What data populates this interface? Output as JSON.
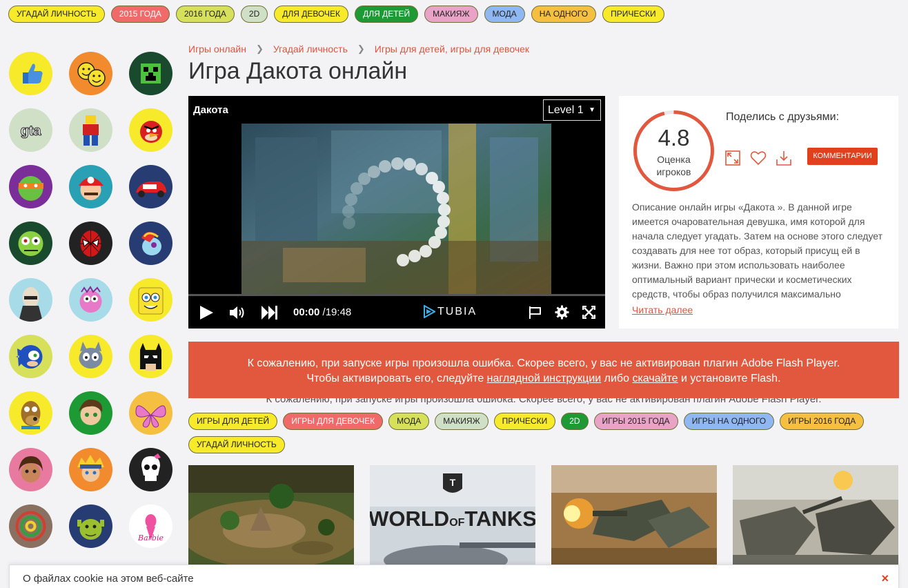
{
  "top_tags": [
    {
      "label": "Угадай личность",
      "color": "#f7ea2a"
    },
    {
      "label": "2015 года",
      "color": "#f06a6a"
    },
    {
      "label": "2016 года",
      "color": "#d7e05a"
    },
    {
      "label": "2D",
      "color": "#cfe0c6"
    },
    {
      "label": "Для девочек",
      "color": "#f7ea2a"
    },
    {
      "label": "Для детей",
      "color": "#1e9a35"
    },
    {
      "label": "Макияж",
      "color": "#e8a3c7"
    },
    {
      "label": "Мода",
      "color": "#8fb8f2"
    },
    {
      "label": "На одного",
      "color": "#f5c042"
    },
    {
      "label": "Прически",
      "color": "#f7ea2a"
    }
  ],
  "sidebar_icons": [
    {
      "name": "like-icon",
      "bg": "#f7ea2a"
    },
    {
      "name": "smiley-icon",
      "bg": "#f28a2e"
    },
    {
      "name": "minecraft-icon",
      "bg": "#1a4a2e"
    },
    {
      "name": "gta-icon",
      "bg": "#cfe0c6"
    },
    {
      "name": "lego-icon",
      "bg": "#cfe0c6"
    },
    {
      "name": "angry-birds-icon",
      "bg": "#f7ea2a"
    },
    {
      "name": "turtle-icon",
      "bg": "#7b2e9a"
    },
    {
      "name": "mario-icon",
      "bg": "#2aa0b4"
    },
    {
      "name": "cars-icon",
      "bg": "#283c74"
    },
    {
      "name": "zombie-icon",
      "bg": "#1a4a2e"
    },
    {
      "name": "spiderman-icon",
      "bg": "#222222"
    },
    {
      "name": "pony-icon",
      "bg": "#283c74"
    },
    {
      "name": "gru-icon",
      "bg": "#a8dbe8"
    },
    {
      "name": "smeshariki-icon",
      "bg": "#a8dbe8"
    },
    {
      "name": "spongebob-icon",
      "bg": "#f7ea2a"
    },
    {
      "name": "sonic-icon",
      "bg": "#d7e05a"
    },
    {
      "name": "tom-jerry-icon",
      "bg": "#f7ea2a"
    },
    {
      "name": "batman-icon",
      "bg": "#f7ea2a"
    },
    {
      "name": "scooby-icon",
      "bg": "#f7ea2a"
    },
    {
      "name": "ben10-icon",
      "bg": "#1e9a35"
    },
    {
      "name": "winx-icon",
      "bg": "#f5c042"
    },
    {
      "name": "dora-icon",
      "bg": "#e87aa0"
    },
    {
      "name": "naruto-icon",
      "bg": "#f28a2e"
    },
    {
      "name": "monster-high-icon",
      "bg": "#222222"
    },
    {
      "name": "zuma-icon",
      "bg": "#8a7060"
    },
    {
      "name": "shrek-icon",
      "bg": "#283c74"
    },
    {
      "name": "barbie-icon",
      "bg": "#ffffff"
    }
  ],
  "breadcrumbs": [
    "Игры онлайн",
    "Угадай личность",
    "Игры для детей, игры для девочек"
  ],
  "page_title": "Игра Дакота онлайн",
  "player": {
    "game_name": "Дакота",
    "level": "Level 1",
    "time_current": "00:00",
    "time_total": "/19:48",
    "brand": "TUBIA"
  },
  "rating": {
    "value": "4.8",
    "label_line1": "Оценка",
    "label_line2": "игроков",
    "fraction": 0.96,
    "color": "#e2583f"
  },
  "share": {
    "title": "Поделись с друзьями:",
    "comments_label": "Комментарии"
  },
  "description": "Описание онлайн игры «Дакота ». В данной игре имеется очаровательная девушка, имя которой для начала следует угадать. Затем на основе этого следует создавать для нее тот образ, который присущ ей в жизни. Важно при этом использовать наиболее оптимальный вариант прически и косметических средств, чтобы образ получился максимально",
  "read_more": "Читать далее",
  "error": {
    "line1": "К сожалению, при запуске игры произошла ошибка. Скорее всего, у вас не активирован плагин Adobe Flash Player.",
    "line2_pre": "Чтобы активировать его, следуйте",
    "link1": "наглядной инструкции",
    "line2_mid": "либо",
    "link2": "скачайте",
    "line2_post": "и установите Flash.",
    "ghost": "К сожалению, при запуске игры произошла ошибка. Скорее всего, у вас не активирован плагин Adobe Flash Player."
  },
  "bottom_tags": [
    {
      "label": "Игры для детей",
      "color": "#f7ea2a"
    },
    {
      "label": "Игры для девочек",
      "color": "#f06a6a"
    },
    {
      "label": "Мода",
      "color": "#d7e05a"
    },
    {
      "label": "Макияж",
      "color": "#cfe0c6"
    },
    {
      "label": "Прически",
      "color": "#f7ea2a"
    },
    {
      "label": "2D",
      "color": "#1e9a35"
    },
    {
      "label": "Игры 2015 года",
      "color": "#e8a3c7"
    },
    {
      "label": "Игры на одного",
      "color": "#8fb8f2"
    },
    {
      "label": "Игры 2016 года",
      "color": "#f5c042"
    },
    {
      "label": "Угадай личность",
      "color": "#f7ea2a"
    }
  ],
  "thumbs": [
    {
      "name": "game-thumb-stone-age"
    },
    {
      "name": "game-thumb-world-of-tanks",
      "logo_line1": "WORLD",
      "logo_of": "OF",
      "logo_line2": "TANKS"
    },
    {
      "name": "game-thumb-tank-fire"
    },
    {
      "name": "game-thumb-mech-tanks"
    }
  ],
  "cookie": {
    "text": "О файлах cookie на этом веб-сайте",
    "close": "×"
  }
}
